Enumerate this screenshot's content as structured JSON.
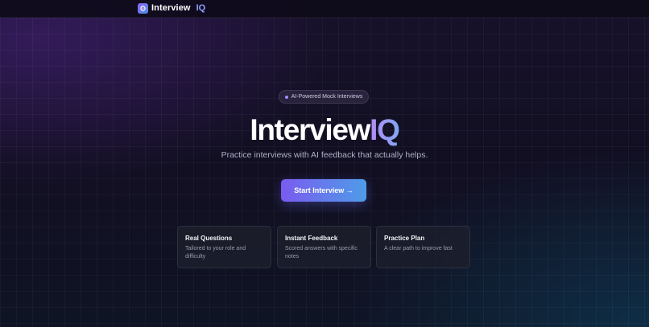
{
  "brand": {
    "name": "Interview",
    "accent": "IQ",
    "logo_icon": "logo-icon"
  },
  "hero": {
    "badge": "AI-Powered Mock Interviews",
    "title_main": "Interview",
    "title_accent": "IQ",
    "subtitle": "Practice interviews with AI feedback that actually helps.",
    "cta_label": "Start Interview →"
  },
  "features": [
    {
      "title": "Real Questions",
      "desc": "Tailored to your role and difficulty"
    },
    {
      "title": "Instant Feedback",
      "desc": "Scored answers with specific notes"
    },
    {
      "title": "Practice Plan",
      "desc": "A clear path to improve fast"
    }
  ],
  "colors": {
    "accent_purple": "#7a5bf0",
    "accent_blue": "#4e9ce8",
    "background": "#140f24"
  }
}
